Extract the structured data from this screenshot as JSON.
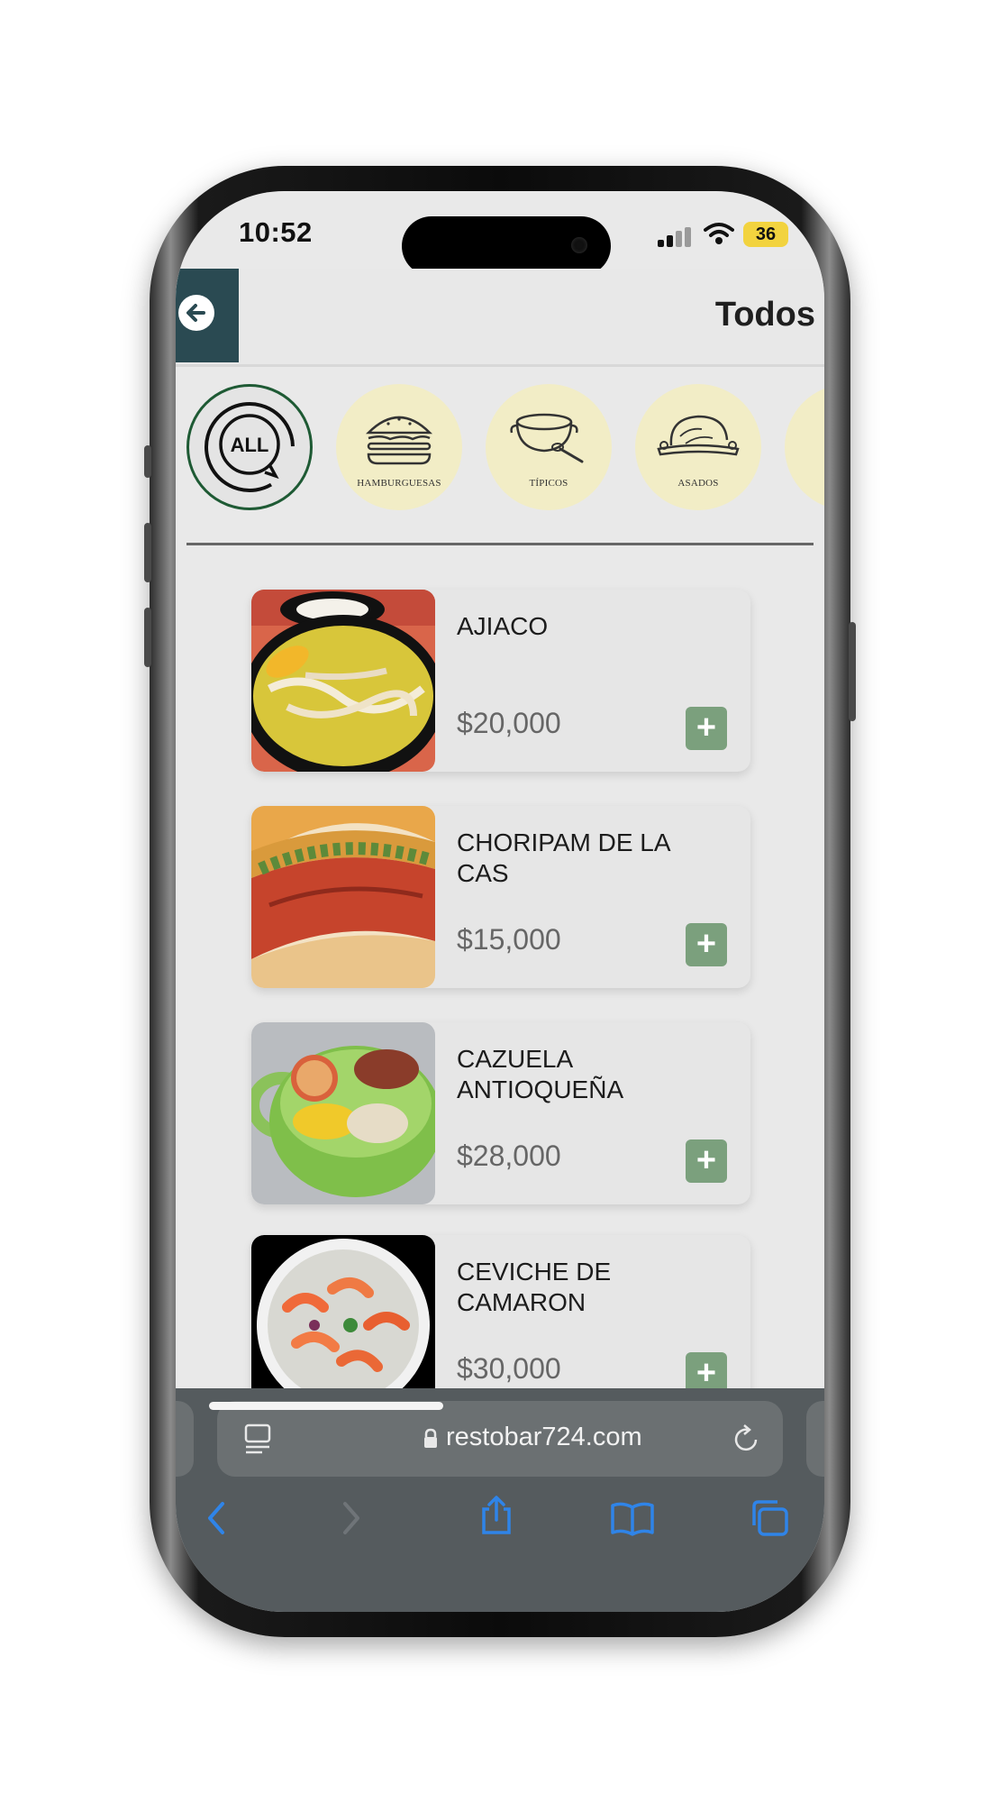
{
  "status_bar": {
    "time": "10:52",
    "battery": "36"
  },
  "header": {
    "title": "Todos"
  },
  "categories": [
    {
      "label": "",
      "icon": "all-icon",
      "selected": true
    },
    {
      "label": "HAMBURGUESAS",
      "icon": "burger-icon"
    },
    {
      "label": "TÍPICOS",
      "icon": "pot-icon"
    },
    {
      "label": "ASADOS",
      "icon": "roast-icon"
    }
  ],
  "all_icon_text": "ALL",
  "products": [
    {
      "name": "AJIACO",
      "price": "$20,000",
      "add": "+"
    },
    {
      "name": "CHORIPAM DE LA CAS",
      "price": "$15,000",
      "add": "+"
    },
    {
      "name": "CAZUELA ANTIOQUEÑA",
      "price": "$28,000",
      "add": "+"
    },
    {
      "name": "CEVICHE DE CAMARON",
      "price": "$30,000",
      "add": "+"
    }
  ],
  "browser": {
    "url": "restobar724.com"
  },
  "colors": {
    "accent": "#7ba07d",
    "header_back": "#2a4a52",
    "category_bg": "#f2edc6",
    "selected_ring": "#1e5a34",
    "toolbar_blue": "#2f84e8"
  }
}
